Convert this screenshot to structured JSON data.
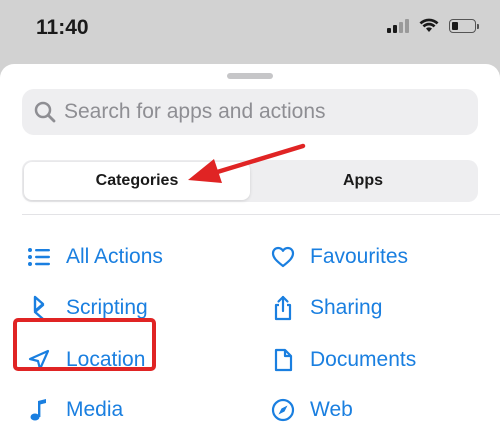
{
  "status": {
    "time": "11:40"
  },
  "search": {
    "placeholder": "Search for apps and actions"
  },
  "segments": {
    "categories": "Categories",
    "apps": "Apps"
  },
  "items": {
    "all_actions": "All Actions",
    "favourites": "Favourites",
    "scripting": "Scripting",
    "sharing": "Sharing",
    "location": "Location",
    "documents": "Documents",
    "media": "Media",
    "web": "Web"
  },
  "colors": {
    "accent": "#1a7fe0",
    "annotation": "#e02424"
  }
}
